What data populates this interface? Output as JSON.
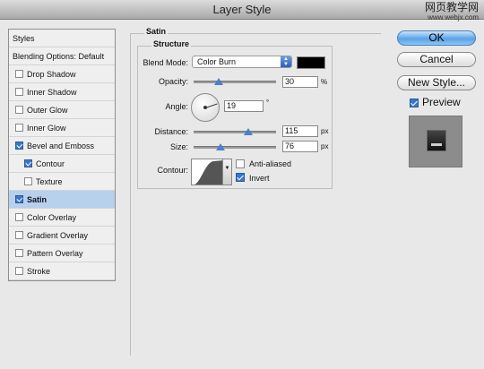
{
  "window": {
    "title": "Layer Style"
  },
  "watermark": {
    "line1": "网页教学网",
    "line2": "www.webjx.com"
  },
  "styles_panel": {
    "header": "Styles",
    "blending": "Blending Options: Default",
    "items": [
      {
        "label": "Drop Shadow",
        "checked": false
      },
      {
        "label": "Inner Shadow",
        "checked": false
      },
      {
        "label": "Outer Glow",
        "checked": false
      },
      {
        "label": "Inner Glow",
        "checked": false
      },
      {
        "label": "Bevel and Emboss",
        "checked": true
      },
      {
        "label": "Contour",
        "checked": true
      },
      {
        "label": "Texture",
        "checked": false
      },
      {
        "label": "Satin",
        "checked": true
      },
      {
        "label": "Color Overlay",
        "checked": false
      },
      {
        "label": "Gradient Overlay",
        "checked": false
      },
      {
        "label": "Pattern Overlay",
        "checked": false
      },
      {
        "label": "Stroke",
        "checked": false
      }
    ]
  },
  "satin": {
    "group_title": "Satin",
    "structure_title": "Structure",
    "blend_mode_label": "Blend Mode:",
    "blend_mode_value": "Color Burn",
    "color": "#000000",
    "opacity_label": "Opacity:",
    "opacity_value": "30",
    "opacity_unit": "%",
    "angle_label": "Angle:",
    "angle_value": "19",
    "angle_unit": "°",
    "distance_label": "Distance:",
    "distance_value": "115",
    "distance_unit": "px",
    "size_label": "Size:",
    "size_value": "76",
    "size_unit": "px",
    "contour_label": "Contour:",
    "anti_aliased_label": "Anti-aliased",
    "anti_aliased": false,
    "invert_label": "Invert",
    "invert": true
  },
  "buttons": {
    "ok": "OK",
    "cancel": "Cancel",
    "new_style": "New Style...",
    "preview_label": "Preview",
    "preview": true
  }
}
